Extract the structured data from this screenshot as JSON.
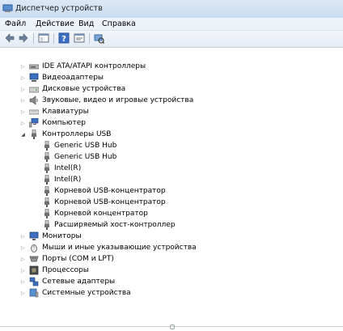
{
  "window": {
    "title": "Диспетчер устройств"
  },
  "menu": [
    "Файл",
    "Действие",
    "Вид",
    "Справка"
  ],
  "toolbar": [
    "back-icon",
    "forward-icon",
    "show-hide-tree-icon",
    "help-icon",
    "properties-icon",
    "scan-hardware-icon"
  ],
  "tree": {
    "top_before": [
      {
        "label": "IDE ATA/ATAPI контроллеры",
        "icon": "ide-controller-icon"
      },
      {
        "label": "Видеоадаптеры",
        "icon": "display-adapter-icon"
      },
      {
        "label": "Дисковые устройства",
        "icon": "disk-drive-icon"
      },
      {
        "label": "Звуковые, видео и игровые устройства",
        "icon": "sound-icon"
      },
      {
        "label": "Клавиатуры",
        "icon": "keyboard-icon"
      },
      {
        "label": "Компьютер",
        "icon": "computer-icon"
      }
    ],
    "usb": {
      "label": "Контроллеры USB",
      "children": [
        "Generic USB Hub",
        "Generic USB Hub",
        "Intel(R)",
        "Intel(R)",
        "Корневой USB-концентратор",
        "Корневой USB-концентратор",
        "Корневой концентратор",
        "Расширяемый хост-контроллер"
      ]
    },
    "top_after": [
      {
        "label": "Мониторы",
        "icon": "monitor-icon"
      },
      {
        "label": "Мыши и иные указывающие устройства",
        "icon": "mouse-icon"
      },
      {
        "label": "Порты (COM и LPT)",
        "icon": "port-icon"
      },
      {
        "label": "Процессоры",
        "icon": "processor-icon"
      },
      {
        "label": "Сетевые адаптеры",
        "icon": "network-adapter-icon"
      },
      {
        "label": "Системные устройства",
        "icon": "system-device-icon"
      }
    ]
  },
  "colors": {
    "usb_plug": "#707070",
    "tree_arrow": "#8a8a8a",
    "folder": "#e8c15a"
  }
}
